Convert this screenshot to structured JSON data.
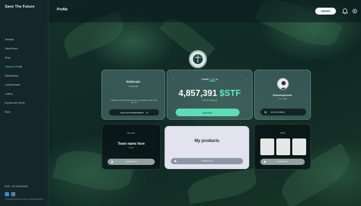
{
  "app": {
    "logo": "Save The Future",
    "page_title": "Profile"
  },
  "sidebar": {
    "items": [
      {
        "label": "Website",
        "chevron": ""
      },
      {
        "label": "SaveFuture",
        "chevron": ""
      },
      {
        "label": "Shop",
        "chevron": "⌄"
      },
      {
        "label": "Teams & Profile",
        "chevron": "⌄"
      },
      {
        "label": "Marketplace",
        "chevron": "⌄"
      },
      {
        "label": "Leaderboards",
        "chevron": "⌄"
      },
      {
        "label": "Lottery",
        "chevron": "⌄"
      },
      {
        "label": "Explore the World",
        "chevron": "⌄"
      },
      {
        "label": "More",
        "chevron": "⌄"
      }
    ],
    "language": "ENG · $ 0.000000000",
    "copyright": "© Copyright Save the Future. All rights reserved."
  },
  "header": {
    "connect_label": "connect"
  },
  "referrals": {
    "title": "Referrals",
    "count": "0",
    "count_label": "referrals",
    "description": "Share your link with friends and get rewards for each new sign-up.",
    "code": "https://STF/A3E6F7E8A4"
  },
  "level": {
    "label": "Level",
    "points": "0 pts",
    "amount": "4,857,391",
    "currency": "$STF",
    "sub": "Your STF balance",
    "cta": "buy more"
  },
  "user": {
    "name": "Subschupstreder",
    "stats": "0 0 · 0 000",
    "rank_label": "see full ranking"
  },
  "team": {
    "heading": "My team",
    "name": "Team name here",
    "id": "#2134",
    "action": "available soon"
  },
  "products": {
    "title": "My products",
    "action": "available soon"
  },
  "nfts": {
    "heading": "NFTs",
    "action": "available soon"
  }
}
